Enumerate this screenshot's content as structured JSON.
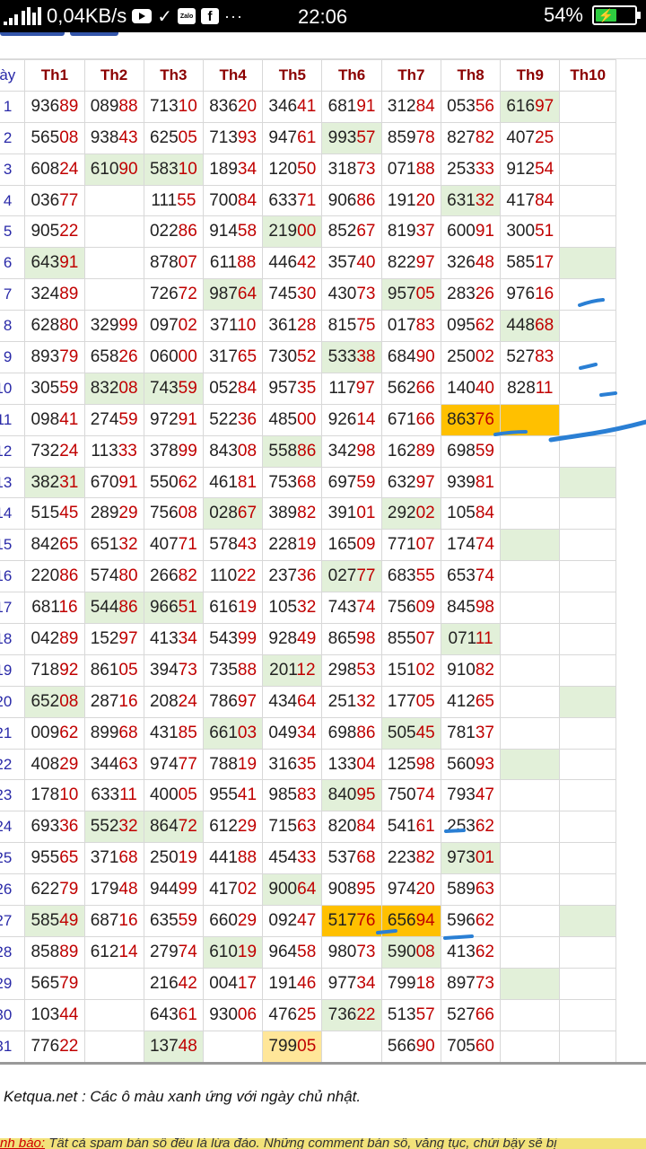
{
  "status_bar": {
    "network_speed": "0,04KB/s",
    "time": "22:06",
    "battery": "54%",
    "icons": [
      "signal-icon",
      "youtube-icon",
      "check-icon",
      "zalo-icon",
      "facebook-icon",
      "more-icon"
    ],
    "zalo_label": "Zalo"
  },
  "table": {
    "corner_label": "Ngày",
    "headers": [
      "Th1",
      "Th2",
      "Th3",
      "Th4",
      "Th5",
      "Th6",
      "Th7",
      "Th8",
      "Th9",
      "Th10"
    ],
    "days": [
      "1",
      "2",
      "3",
      "4",
      "5",
      "6",
      "7",
      "8",
      "9",
      "10",
      "11",
      "12",
      "13",
      "14",
      "15",
      "16",
      "17",
      "18",
      "19",
      "20",
      "21",
      "22",
      "23",
      "24",
      "25",
      "26",
      "27",
      "28",
      "29",
      "30",
      "31"
    ],
    "rows": [
      [
        "93689",
        "08988",
        "71310",
        "83620",
        "34641",
        "68191",
        "31284",
        "05356",
        "61697",
        ""
      ],
      [
        "56508",
        "93843",
        "62505",
        "71393",
        "94761",
        "99357",
        "85978",
        "82782",
        "40725",
        ""
      ],
      [
        "60824",
        "61090",
        "58310",
        "18934",
        "12050",
        "31873",
        "07188",
        "25333",
        "91254",
        ""
      ],
      [
        "03677",
        "",
        "11155",
        "70084",
        "63371",
        "90686",
        "19120",
        "63132",
        "41784",
        ""
      ],
      [
        "90522",
        "",
        "02286",
        "91458",
        "21900",
        "85267",
        "81937",
        "60091",
        "30051",
        ""
      ],
      [
        "64391",
        "",
        "87807",
        "61188",
        "44642",
        "35740",
        "82297",
        "32648",
        "58517",
        ""
      ],
      [
        "32489",
        "",
        "72672",
        "98764",
        "74530",
        "43073",
        "95705",
        "28326",
        "97616",
        ""
      ],
      [
        "62880",
        "32999",
        "09702",
        "37110",
        "36128",
        "81575",
        "01783",
        "09562",
        "44868",
        ""
      ],
      [
        "89379",
        "65826",
        "06000",
        "31765",
        "73052",
        "53338",
        "68490",
        "25002",
        "52783",
        ""
      ],
      [
        "30559",
        "83208",
        "74359",
        "05284",
        "95735",
        "11797",
        "56266",
        "14040",
        "82811",
        ""
      ],
      [
        "09841",
        "27459",
        "97291",
        "52236",
        "48500",
        "92614",
        "67166",
        "86376",
        "",
        ""
      ],
      [
        "73224",
        "11333",
        "37899",
        "84308",
        "55886",
        "34298",
        "16289",
        "69859",
        "",
        ""
      ],
      [
        "38231",
        "67091",
        "55062",
        "46181",
        "75368",
        "69759",
        "63297",
        "93981",
        "",
        ""
      ],
      [
        "51545",
        "28929",
        "75608",
        "02867",
        "38982",
        "39101",
        "29202",
        "10584",
        "",
        ""
      ],
      [
        "84265",
        "65132",
        "40771",
        "57843",
        "22819",
        "16509",
        "77107",
        "17474",
        "",
        ""
      ],
      [
        "22086",
        "57480",
        "26682",
        "11022",
        "23736",
        "02777",
        "68355",
        "65374",
        "",
        ""
      ],
      [
        "68116",
        "54486",
        "96651",
        "61619",
        "10532",
        "74374",
        "75609",
        "84598",
        "",
        ""
      ],
      [
        "04289",
        "15297",
        "41334",
        "54399",
        "92849",
        "86598",
        "85507",
        "07111",
        "",
        ""
      ],
      [
        "71892",
        "86105",
        "39473",
        "73588",
        "20112",
        "29853",
        "15102",
        "91082",
        "",
        ""
      ],
      [
        "65208",
        "28716",
        "20824",
        "78697",
        "43464",
        "25132",
        "17705",
        "41265",
        "",
        ""
      ],
      [
        "00962",
        "89968",
        "43185",
        "66103",
        "04934",
        "69886",
        "50545",
        "78137",
        "",
        ""
      ],
      [
        "40829",
        "34463",
        "97477",
        "78819",
        "31635",
        "13304",
        "12598",
        "56093",
        "",
        ""
      ],
      [
        "17810",
        "63311",
        "40005",
        "95541",
        "98583",
        "84095",
        "75074",
        "79347",
        "",
        ""
      ],
      [
        "69336",
        "55232",
        "86472",
        "61229",
        "71563",
        "82084",
        "54161",
        "25362",
        "",
        ""
      ],
      [
        "95565",
        "37168",
        "25019",
        "44188",
        "45433",
        "53768",
        "22382",
        "97301",
        "",
        ""
      ],
      [
        "62279",
        "17948",
        "94499",
        "41702",
        "90064",
        "90895",
        "97420",
        "58963",
        "",
        ""
      ],
      [
        "58549",
        "68716",
        "63559",
        "66029",
        "09247",
        "51776",
        "65694",
        "59662",
        "",
        ""
      ],
      [
        "85889",
        "61214",
        "27974",
        "61019",
        "96458",
        "98073",
        "59008",
        "41362",
        "",
        ""
      ],
      [
        "56579",
        "",
        "21642",
        "00417",
        "19146",
        "97734",
        "79918",
        "89773",
        "",
        ""
      ],
      [
        "10344",
        "",
        "64361",
        "93006",
        "47625",
        "73622",
        "51357",
        "52766",
        "",
        ""
      ],
      [
        "77622",
        "",
        "13748",
        "",
        "79905",
        "",
        "56690",
        "70560",
        "",
        ""
      ]
    ],
    "highlights": {
      "0": {
        "8": "green"
      },
      "1": {
        "5": "green"
      },
      "2": {
        "1": "green",
        "2": "green"
      },
      "3": {
        "7": "green"
      },
      "4": {
        "4": "green"
      },
      "5": {
        "0": "green",
        "9": "green"
      },
      "6": {
        "3": "green",
        "6": "green"
      },
      "7": {
        "8": "green"
      },
      "8": {
        "5": "green"
      },
      "9": {
        "1": "green",
        "2": "green"
      },
      "10": {
        "7": "orange",
        "8": "orange"
      },
      "11": {
        "4": "green"
      },
      "12": {
        "0": "green",
        "9": "green"
      },
      "13": {
        "3": "green",
        "6": "green"
      },
      "14": {
        "8": "green"
      },
      "15": {
        "5": "green"
      },
      "16": {
        "1": "green",
        "2": "green"
      },
      "17": {
        "7": "green"
      },
      "18": {
        "4": "green"
      },
      "19": {
        "0": "green",
        "9": "green"
      },
      "20": {
        "3": "green",
        "6": "green"
      },
      "21": {
        "8": "green"
      },
      "22": {
        "5": "green"
      },
      "23": {
        "1": "green",
        "2": "green"
      },
      "24": {
        "7": "green"
      },
      "25": {
        "4": "green"
      },
      "26": {
        "0": "green",
        "5": "orange",
        "6": "orange",
        "9": "green"
      },
      "27": {
        "3": "green",
        "6": "green"
      },
      "28": {
        "8": "green"
      },
      "29": {
        "5": "green"
      },
      "30": {
        "2": "green",
        "4": "yellow"
      }
    }
  },
  "footer": {
    "note": "Ketqua.net : Các ô màu xanh ứng với ngày chủ nhật.",
    "warning_label": "nh báo:",
    "warning_text": " Tất cả spam bán số đều là lừa đảo. Những comment bán số, văng tục, chửi bậy sẽ bị"
  },
  "colors": {
    "header_text": "#8b0000",
    "day_text": "#2929a8",
    "digits_red": "#c00000",
    "sunday_green": "#e2f0d9",
    "highlight_orange": "#ffc000",
    "highlight_yellow": "#ffe699",
    "pen_marks": "#2a7fd4"
  }
}
